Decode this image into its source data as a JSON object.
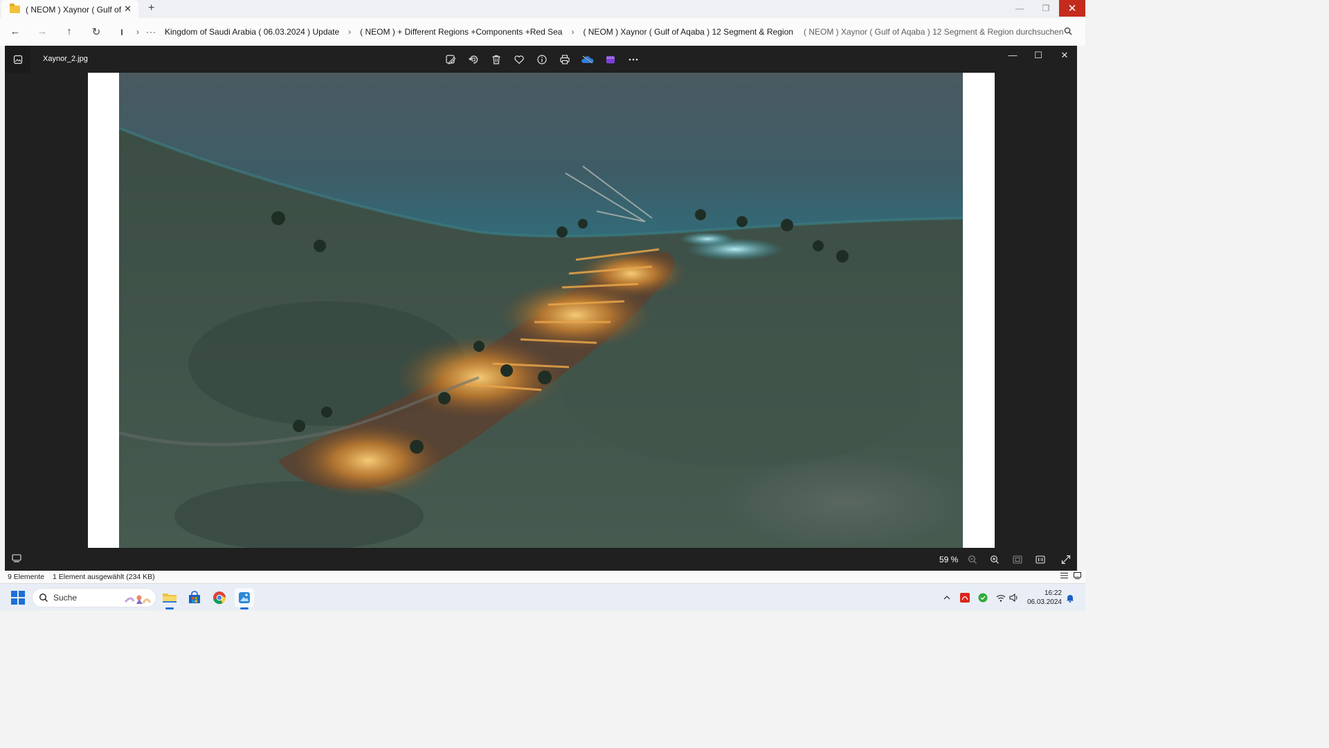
{
  "explorer": {
    "tab_title": "( NEOM ) Xaynor ( Gulf of Aqa",
    "tab_close": "✕",
    "new_tab": "+",
    "window_controls": {
      "minimize": "—",
      "restore": "❐",
      "close": "✕"
    },
    "nav": {
      "back": "←",
      "forward": "→",
      "up": "↑",
      "refresh": "↻"
    },
    "breadcrumb": {
      "overflow": "···",
      "items": [
        "Kingdom of Saudi Arabia ( 06.03.2024 ) Update",
        "( NEOM ) + Different Regions +Components +Red Sea",
        "( NEOM ) Xaynor ( Gulf of Aqaba ) 12 Segment & Region"
      ]
    },
    "search_placeholder": "( NEOM ) Xaynor ( Gulf of Aqaba ) 12 Segment & Region durchsuchen",
    "status": {
      "items_count": "9 Elemente",
      "selection": "1 Element ausgewählt (234 KB)"
    }
  },
  "viewer": {
    "file_name": "Xaynor_2.jpg",
    "toolbar_icons": [
      "edit-image-icon",
      "rotate-icon",
      "delete-icon",
      "favorite-icon",
      "info-icon",
      "print-icon",
      "onedrive-icon",
      "clipchamp-icon",
      "more-icon"
    ],
    "window_controls": {
      "minimize": "—",
      "maximize": "☐",
      "close": "✕"
    },
    "zoom_level": "59 %"
  },
  "taskbar": {
    "search_label": "Suche",
    "apps": [
      "file-explorer-icon",
      "microsoft-store-icon",
      "chrome-icon",
      "photos-icon"
    ],
    "clock_time": "16:22",
    "clock_date": "06.03.2024"
  },
  "colors": {
    "close_red": "#c42b1c",
    "viewer_bg": "#202020",
    "accent": "#1c6fd8"
  }
}
